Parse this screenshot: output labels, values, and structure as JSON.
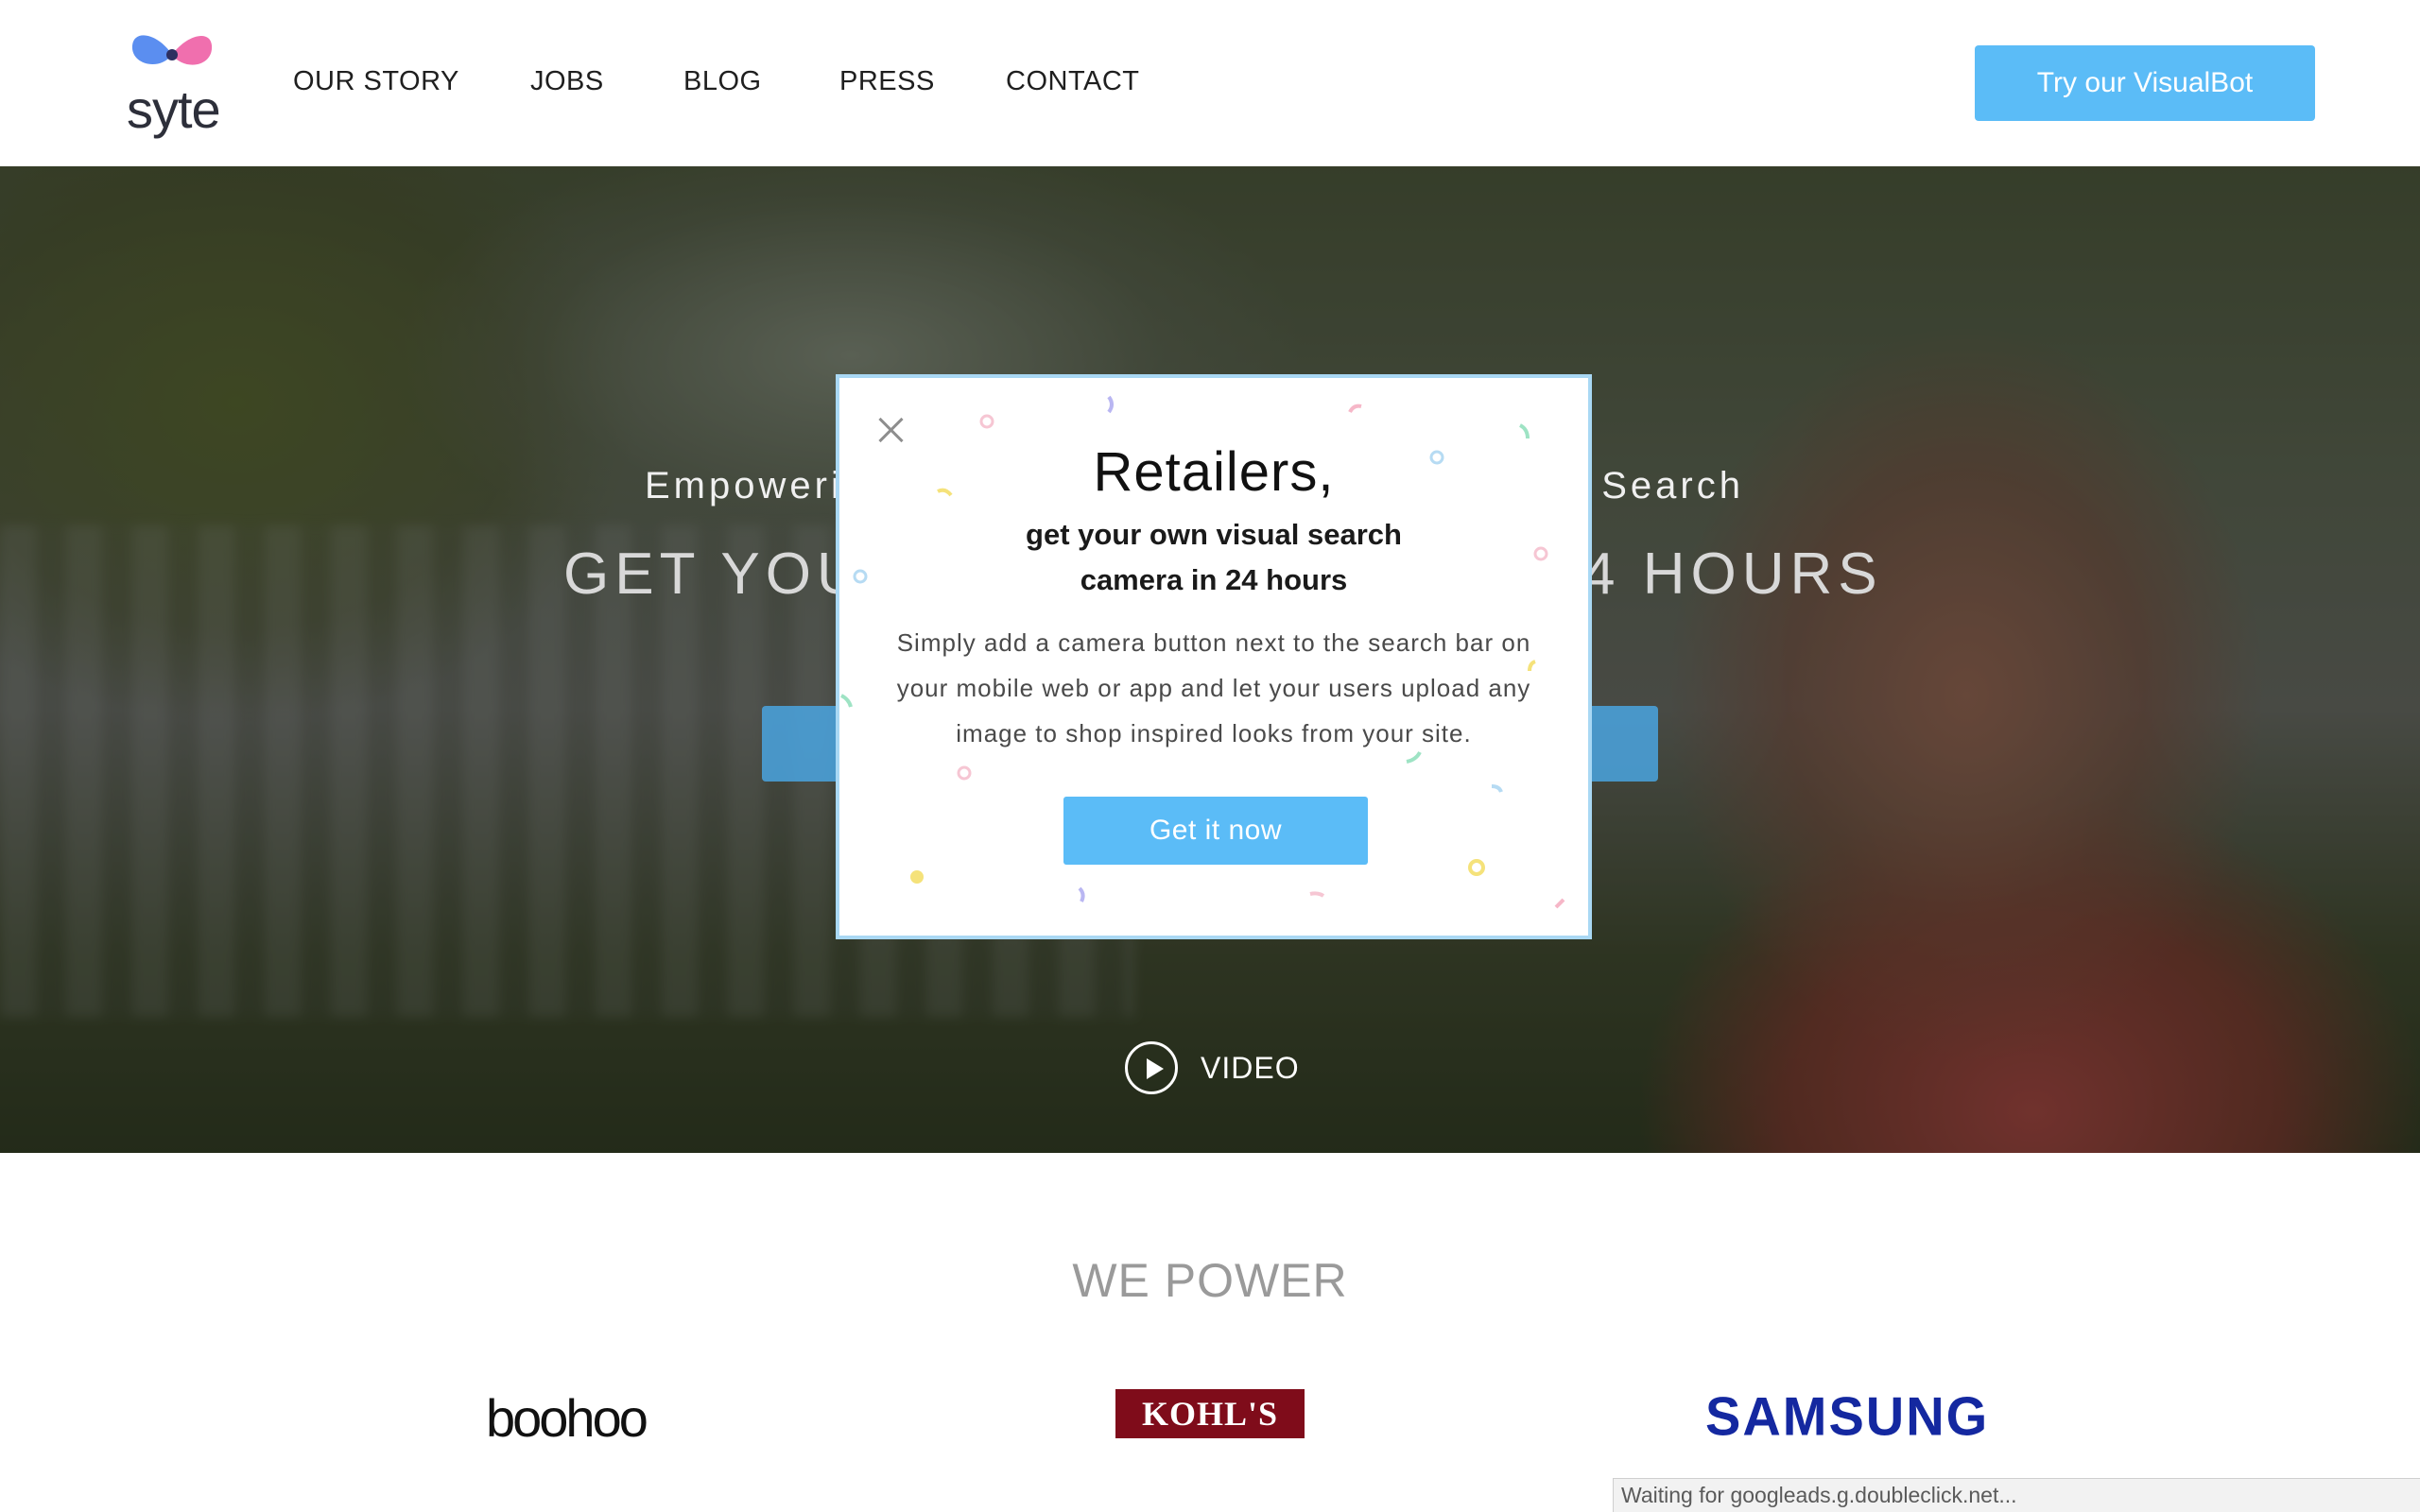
{
  "header": {
    "logo_text": "syte",
    "nav": [
      "OUR STORY",
      "JOBS",
      "BLOG",
      "PRESS",
      "CONTACT"
    ],
    "cta_label": "Try our VisualBot"
  },
  "hero": {
    "tagline_left": "Empoweri",
    "tagline_right": "al Search",
    "headline_left": "GET YOU",
    "headline_right": "4 HOURS",
    "video_label": "VIDEO"
  },
  "modal": {
    "title": "Retailers,",
    "subtitle": "get your own visual search camera in 24 hours",
    "body": "Simply add a camera button next to the search bar on your mobile web or app and let your users upload any image to shop inspired looks from your site.",
    "cta_label": "Get it now"
  },
  "partners": {
    "heading": "WE POWER",
    "brands": [
      "boohoo",
      "KOHL'S",
      "SAMSUNG"
    ]
  },
  "status_bar": {
    "text": "Waiting for googleads.g.doubleclick.net..."
  },
  "colors": {
    "accent": "#5bbcf7",
    "modal_border": "#a9d8f4",
    "kohls_red": "#7f0c1a",
    "samsung_blue": "#1428a0"
  }
}
